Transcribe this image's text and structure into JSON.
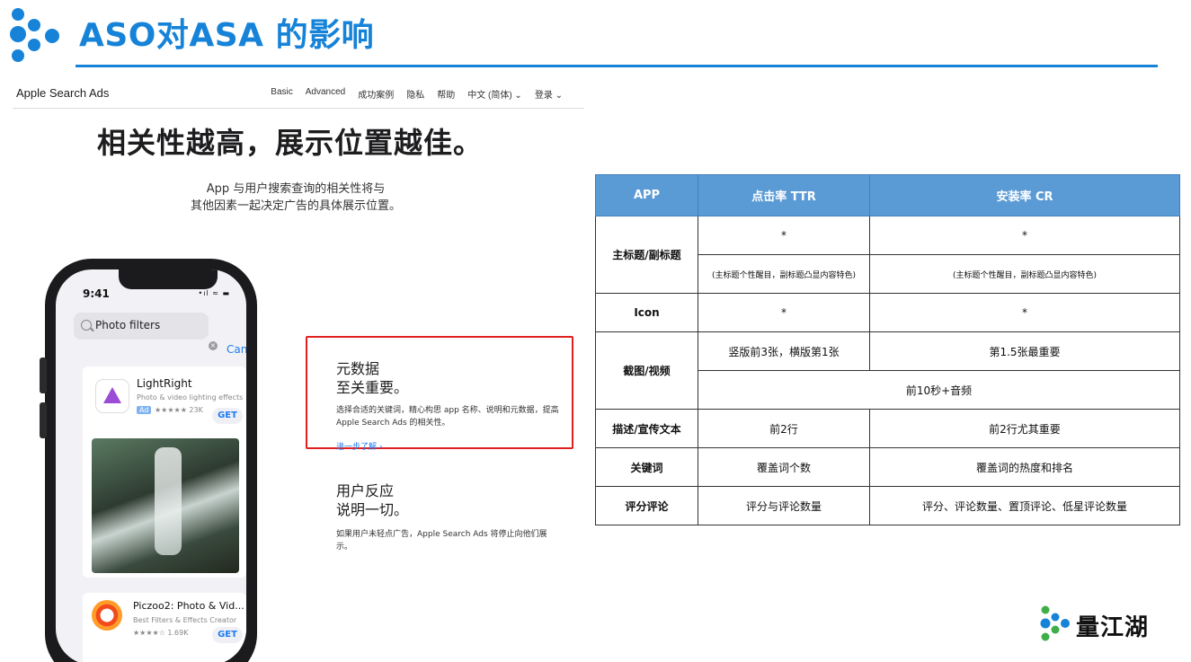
{
  "slide": {
    "title": "ASO对ASA 的影响",
    "accent_color": "#1683d8",
    "logo_icon": "liangjianghu-logo-icon"
  },
  "screenshot": {
    "nav": {
      "brand": "Apple Search Ads",
      "links": [
        "Basic",
        "Advanced",
        "成功案例",
        "隐私",
        "帮助",
        "中文 (简体) ⌄",
        "登录 ⌄"
      ]
    },
    "hero_title": "相关性越高，展示位置越佳。",
    "hero_subtitle_line1": "App 与用户搜索查询的相关性将与",
    "hero_subtitle_line2": "其他因素一起决定广告的具体展示位置。",
    "phone": {
      "time": "9:41",
      "status": "•ıl ≈ ▬",
      "search_text": "Photo filters",
      "cancel": "Cancel",
      "app1_name": "LightRight",
      "app1_subtitle": "Photo & video lighting effects",
      "app1_ad": "Ad",
      "app1_rating": "★★★★★ 23K",
      "get": "GET",
      "app2_name": "Piczoo2: Photo & Vid...",
      "app2_subtitle": "Best Filters & Effects Creator",
      "app2_rating": "★★★★☆ 1.69K"
    },
    "section1": {
      "heading": "元数据\n至关重要。",
      "body": "选择合适的关键词，精心构思 app 名称、说明和元数据，提高 Apple Search Ads 的相关性。",
      "link": "进一步了解 ›",
      "highlight_color": "#e02020"
    },
    "section2": {
      "heading": "用户反应\n说明一切。",
      "body": "如果用户未轻点广告，Apple Search Ads 将停止向他们展示。"
    }
  },
  "table": {
    "header_color": "#5b9bd5",
    "headers": [
      "APP",
      "点击率 TTR",
      "安装率 CR"
    ],
    "rows": {
      "title": {
        "label": "主标题/副标题",
        "ttr_1": "*",
        "cr_1": "*",
        "ttr_2": "(主标题个性醒目，副标题凸显内容特色)",
        "cr_2": "(主标题个性醒目，副标题凸显内容特色)"
      },
      "icon": {
        "label": "Icon",
        "ttr": "*",
        "cr": "*"
      },
      "screenshot": {
        "label": "截图/视频",
        "ttr": "竖版前3张，横版第1张",
        "cr": "第1.5张最重要",
        "merged": "前10秒+音频"
      },
      "description": {
        "label": "描述/宣传文本",
        "ttr": "前2行",
        "cr": "前2行尤其重要"
      },
      "keywords": {
        "label": "关键词",
        "ttr": "覆盖词个数",
        "cr": "覆盖词的热度和排名"
      },
      "ratings": {
        "label": "评分评论",
        "ttr": "评分与评论数量",
        "cr": "评分、评论数量、置顶评论、低星评论数量"
      }
    }
  },
  "brand": {
    "name": "量江湖",
    "icon": "liangjianghu-logo-icon"
  }
}
